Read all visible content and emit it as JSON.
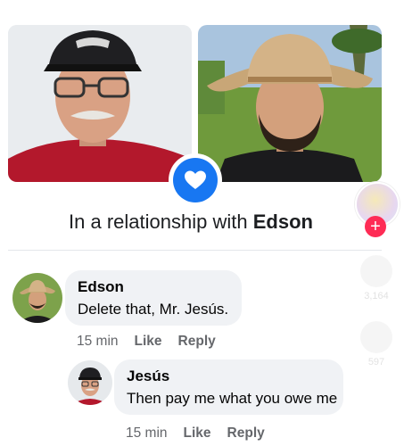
{
  "post": {
    "relationship_prefix": "In a relationship with",
    "relationship_name": "Edson"
  },
  "comments": [
    {
      "author": "Edson",
      "text": "Delete that, Mr. Jesús.",
      "time": "15 min",
      "like_label": "Like",
      "reply_label": "Reply"
    },
    {
      "author": "Jesús",
      "text": "Then pay me what you owe me",
      "time": "15 min",
      "like_label": "Like",
      "reply_label": "Reply"
    }
  ],
  "side_overlay": {
    "like_count": "3,164",
    "comment_count": "597"
  },
  "colors": {
    "accent": "#1877f2",
    "bubble": "#f0f2f5",
    "muted": "#65676b",
    "side_plus": "#fe2c55"
  },
  "icons": {
    "badge": "heart-icon",
    "side_like": "heart-icon",
    "side_comment": "comment-icon",
    "side_plus": "plus-icon"
  }
}
